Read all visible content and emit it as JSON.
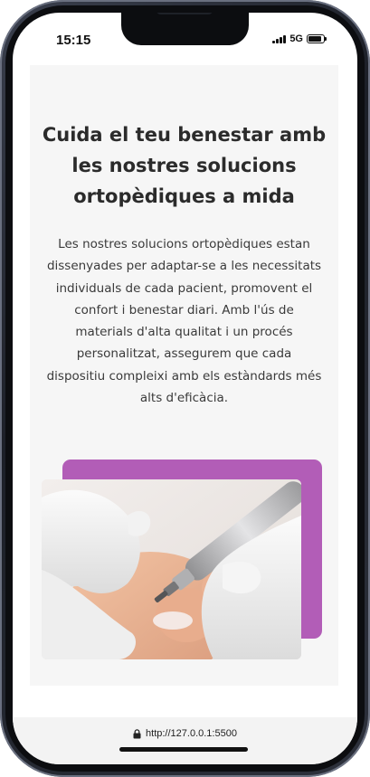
{
  "status_bar": {
    "time": "15:15",
    "network": "5G",
    "battery_level": 0.9,
    "signal_bars": 4
  },
  "hero": {
    "heading": "Cuida el teu benestar amb les nostres solucions ortopèdiques a mida",
    "paragraph": "Les nostres solucions ortopèdiques estan dissenyades per adaptar-se a les necessitats individuals de cada pacient, promovent el confort i benestar diari. Amb l'ús de materials d'alta qualitat i un procés personalitzat, assegurem que cada dispositiu compleixi amb els estàndards més alts d'eficàcia.",
    "accent_color": "#b25db7"
  },
  "browser": {
    "url": "http://127.0.0.1:5500",
    "lock_icon": "lock-icon"
  }
}
